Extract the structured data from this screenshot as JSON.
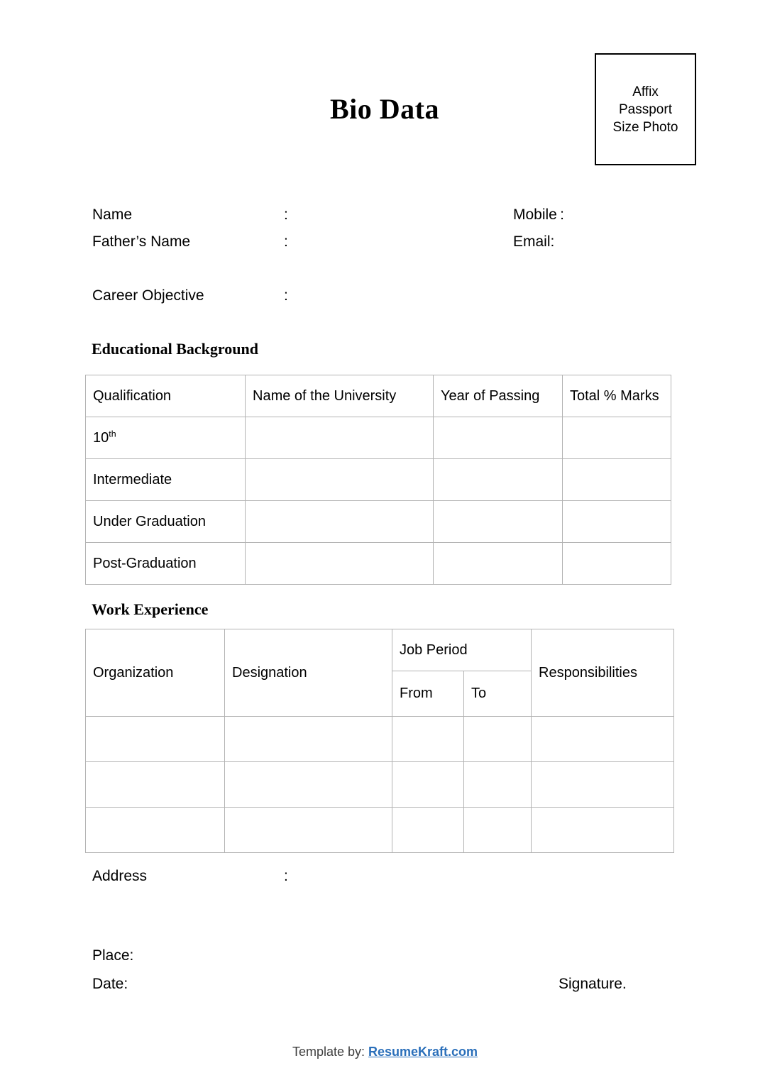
{
  "document": {
    "title": "Bio Data",
    "photo_box": {
      "line1": "Affix",
      "line2": "Passport",
      "line3": "Size Photo"
    }
  },
  "personal": {
    "name": {
      "label": "Name",
      "colon": ":",
      "value": ""
    },
    "fathers_name": {
      "label": "Father’s Name",
      "colon": ":",
      "value": ""
    },
    "career_objective": {
      "label": "Career Objective",
      "colon": ":",
      "value": ""
    },
    "mobile": {
      "label": "Mobile :",
      "value": ""
    },
    "email": {
      "label": "Email:",
      "value": ""
    }
  },
  "education": {
    "heading": "Educational Background",
    "columns": [
      "Qualification",
      "Name of the University",
      "Year of Passing",
      "Total % Marks"
    ],
    "rows": [
      {
        "qualification": "10",
        "ordinal": "th",
        "university": "",
        "year": "",
        "marks": ""
      },
      {
        "qualification": "Intermediate",
        "ordinal": "",
        "university": "",
        "year": "",
        "marks": ""
      },
      {
        "qualification": "Under Graduation",
        "ordinal": "",
        "university": "",
        "year": "",
        "marks": ""
      },
      {
        "qualification": "Post-Graduation",
        "ordinal": "",
        "university": "",
        "year": "",
        "marks": ""
      }
    ]
  },
  "work": {
    "heading": "Work Experience",
    "columns": [
      "Organization",
      "Designation",
      "Job Period",
      "Responsibilities"
    ],
    "subcolumns": {
      "from": "From",
      "to": "To"
    },
    "rows": [
      {
        "organization": "",
        "designation": "",
        "from": "",
        "to": "",
        "responsibilities": ""
      },
      {
        "organization": "",
        "designation": "",
        "from": "",
        "to": "",
        "responsibilities": ""
      },
      {
        "organization": "",
        "designation": "",
        "from": "",
        "to": "",
        "responsibilities": ""
      }
    ]
  },
  "address": {
    "label": "Address",
    "colon": ":",
    "value": ""
  },
  "signoff": {
    "place": "Place:",
    "date": "Date:",
    "signature": "Signature."
  },
  "credit": {
    "prefix": "Template by: ",
    "link_text": "ResumeKraft.com",
    "link_color": "#2a6fba"
  }
}
